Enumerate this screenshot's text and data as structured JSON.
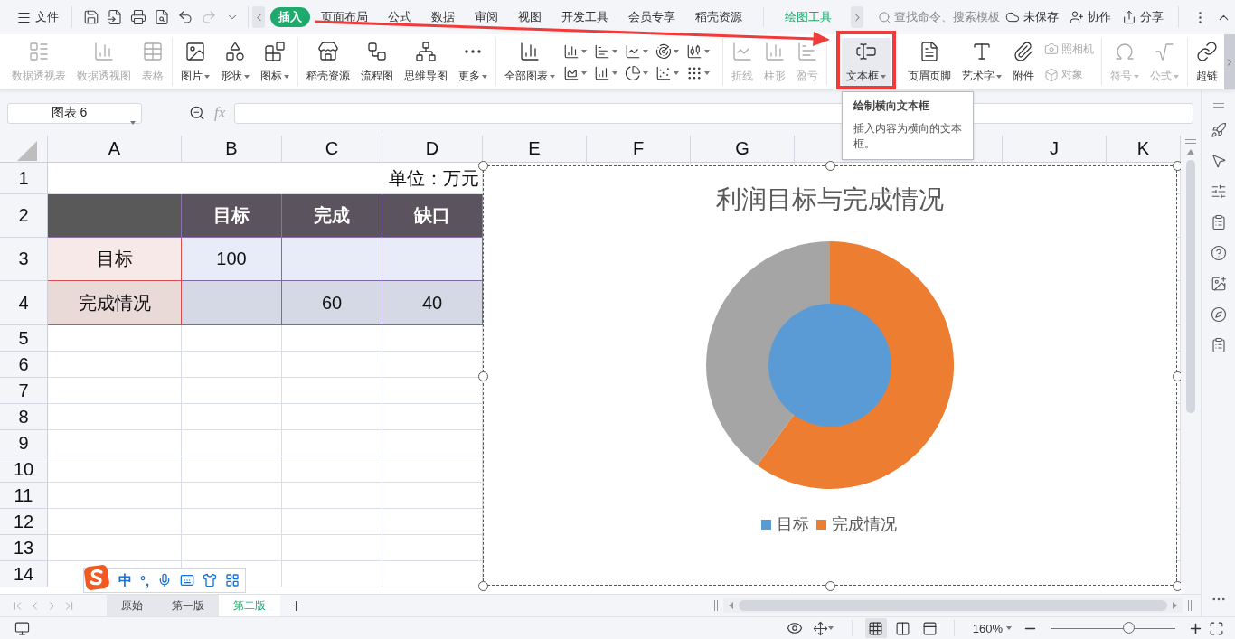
{
  "menu_bar": {
    "menu_label": "文件",
    "tabs": [
      {
        "label": "插入",
        "selected": true,
        "kind": "standard"
      },
      {
        "label": "页面布局",
        "selected": false,
        "kind": "standard"
      },
      {
        "label": "公式",
        "selected": false,
        "kind": "standard"
      },
      {
        "label": "数据",
        "selected": false,
        "kind": "standard"
      },
      {
        "label": "审阅",
        "selected": false,
        "kind": "standard"
      },
      {
        "label": "视图",
        "selected": false,
        "kind": "standard"
      },
      {
        "label": "开发工具",
        "selected": false,
        "kind": "standard"
      },
      {
        "label": "会员专享",
        "selected": false,
        "kind": "standard"
      },
      {
        "label": "稻壳资源",
        "selected": false,
        "kind": "standard"
      },
      {
        "label": "绘图工具",
        "selected": false,
        "kind": "contextual"
      }
    ],
    "search": {
      "placeholder": "查找命令、搜索模板"
    },
    "actions": [
      {
        "label": "未保存",
        "kind": "cloud"
      },
      {
        "label": "协作",
        "kind": "people"
      },
      {
        "label": "分享",
        "kind": "share"
      }
    ]
  },
  "ribbon": {
    "groups": [
      {
        "items": [
          {
            "label": "数据透视表",
            "kind": "large",
            "disabled": true,
            "dropdown": false,
            "hovered": false
          },
          {
            "label": "数据透视图",
            "kind": "large",
            "disabled": true,
            "dropdown": false,
            "hovered": false
          },
          {
            "label": "表格",
            "kind": "large",
            "disabled": true,
            "dropdown": false,
            "hovered": false
          }
        ]
      },
      {
        "items": [
          {
            "label": "图片",
            "kind": "large",
            "disabled": false,
            "dropdown": true,
            "hovered": false
          },
          {
            "label": "形状",
            "kind": "large",
            "disabled": false,
            "dropdown": true,
            "hovered": false
          },
          {
            "label": "图标",
            "kind": "large",
            "disabled": false,
            "dropdown": true,
            "hovered": false
          }
        ]
      },
      {
        "items": [
          {
            "label": "稻壳资源",
            "kind": "large",
            "disabled": false,
            "dropdown": false,
            "hovered": false
          },
          {
            "label": "流程图",
            "kind": "large",
            "disabled": false,
            "dropdown": false,
            "hovered": false
          },
          {
            "label": "思维导图",
            "kind": "large",
            "disabled": false,
            "dropdown": false,
            "hovered": false
          },
          {
            "label": "更多",
            "kind": "large",
            "disabled": false,
            "dropdown": true,
            "hovered": false
          }
        ]
      },
      {
        "items": [
          {
            "label": "全部图表",
            "kind": "large",
            "disabled": false,
            "dropdown": true,
            "hovered": false
          },
          {
            "kind": "chart-grid",
            "disabled": false,
            "dropdown": true,
            "hovered": false
          }
        ]
      },
      {
        "items": [
          {
            "label": "折线",
            "kind": "large",
            "disabled": true,
            "dropdown": false,
            "hovered": false
          },
          {
            "label": "柱形",
            "kind": "large",
            "disabled": true,
            "dropdown": false,
            "hovered": false
          },
          {
            "label": "盈亏",
            "kind": "large",
            "disabled": true,
            "dropdown": false,
            "hovered": false
          }
        ]
      },
      {
        "items": [
          {
            "label": "文本框",
            "kind": "large",
            "disabled": false,
            "dropdown": true,
            "hovered": true
          },
          {
            "label": "页眉页脚",
            "kind": "large",
            "disabled": false,
            "dropdown": false,
            "hovered": false
          },
          {
            "label": "艺术字",
            "kind": "large",
            "disabled": false,
            "dropdown": true,
            "hovered": false
          },
          {
            "label": "附件",
            "kind": "large",
            "disabled": false,
            "dropdown": false,
            "hovered": false
          },
          {
            "label": "照相机",
            "kind": "small",
            "disabled": true,
            "dropdown": false,
            "hovered": false
          },
          {
            "label": "对象",
            "kind": "small",
            "disabled": true,
            "dropdown": false,
            "hovered": false
          }
        ]
      },
      {
        "items": [
          {
            "label": "符号",
            "kind": "large",
            "disabled": true,
            "dropdown": true,
            "hovered": false
          },
          {
            "label": "公式",
            "kind": "large",
            "disabled": true,
            "dropdown": true,
            "hovered": false
          }
        ]
      },
      {
        "items": [
          {
            "label": "超链",
            "kind": "large",
            "disabled": false,
            "dropdown": false,
            "hovered": false
          }
        ]
      }
    ]
  },
  "tooltip": {
    "title": "绘制横向文本框",
    "body": "插入内容为横向的文本框。"
  },
  "formula_bar": {
    "name_box": "图表 6",
    "function_label": "fx"
  },
  "sheet": {
    "columns": [
      "A",
      "B",
      "C",
      "D",
      "E",
      "F",
      "G",
      "J",
      "K"
    ],
    "rows": [
      {
        "number": "1",
        "cells": [
          {
            "kind": "banner",
            "text": "单位：万元"
          }
        ]
      },
      {
        "number": "2",
        "cells": [
          {
            "kind": "corner"
          },
          {
            "kind": "header",
            "text": "目标"
          },
          {
            "kind": "header",
            "text": "完成"
          },
          {
            "kind": "header",
            "text": "缺口"
          }
        ]
      },
      {
        "number": "3",
        "cells": [
          {
            "kind": "label",
            "text": "目标"
          },
          {
            "kind": "value",
            "text": "100"
          },
          {
            "kind": "value"
          },
          {
            "kind": "value"
          }
        ]
      },
      {
        "number": "4",
        "cells": [
          {
            "kind": "label-alt",
            "text": "完成情况"
          },
          {
            "kind": "value-alt"
          },
          {
            "kind": "value-alt",
            "text": "60"
          },
          {
            "kind": "value-alt",
            "text": "40"
          }
        ]
      },
      {
        "number": "5"
      },
      {
        "number": "6"
      },
      {
        "number": "7"
      },
      {
        "number": "8"
      },
      {
        "number": "9"
      },
      {
        "number": "10"
      },
      {
        "number": "11"
      },
      {
        "number": "12"
      },
      {
        "number": "13"
      },
      {
        "number": "14"
      }
    ]
  },
  "chart": {
    "title": "利润目标与完成情况",
    "legend": [
      {
        "label": "目标",
        "color": "#5b9bd5"
      },
      {
        "label": "完成情况",
        "color": "#ed7d31"
      }
    ]
  },
  "ime": {
    "mode": "中",
    "punctuation": "°,"
  },
  "sheet_tabs": [
    {
      "label": "原始",
      "selected": false
    },
    {
      "label": "第一版",
      "selected": false
    },
    {
      "label": "第二版",
      "selected": true
    }
  ],
  "status_bar": {
    "views": [
      {
        "kind": "normal",
        "selected": true
      },
      {
        "kind": "page-break",
        "selected": false
      },
      {
        "kind": "page-layout",
        "selected": false
      }
    ],
    "zoom": {
      "label": "160%",
      "level": 0.62
    }
  }
}
